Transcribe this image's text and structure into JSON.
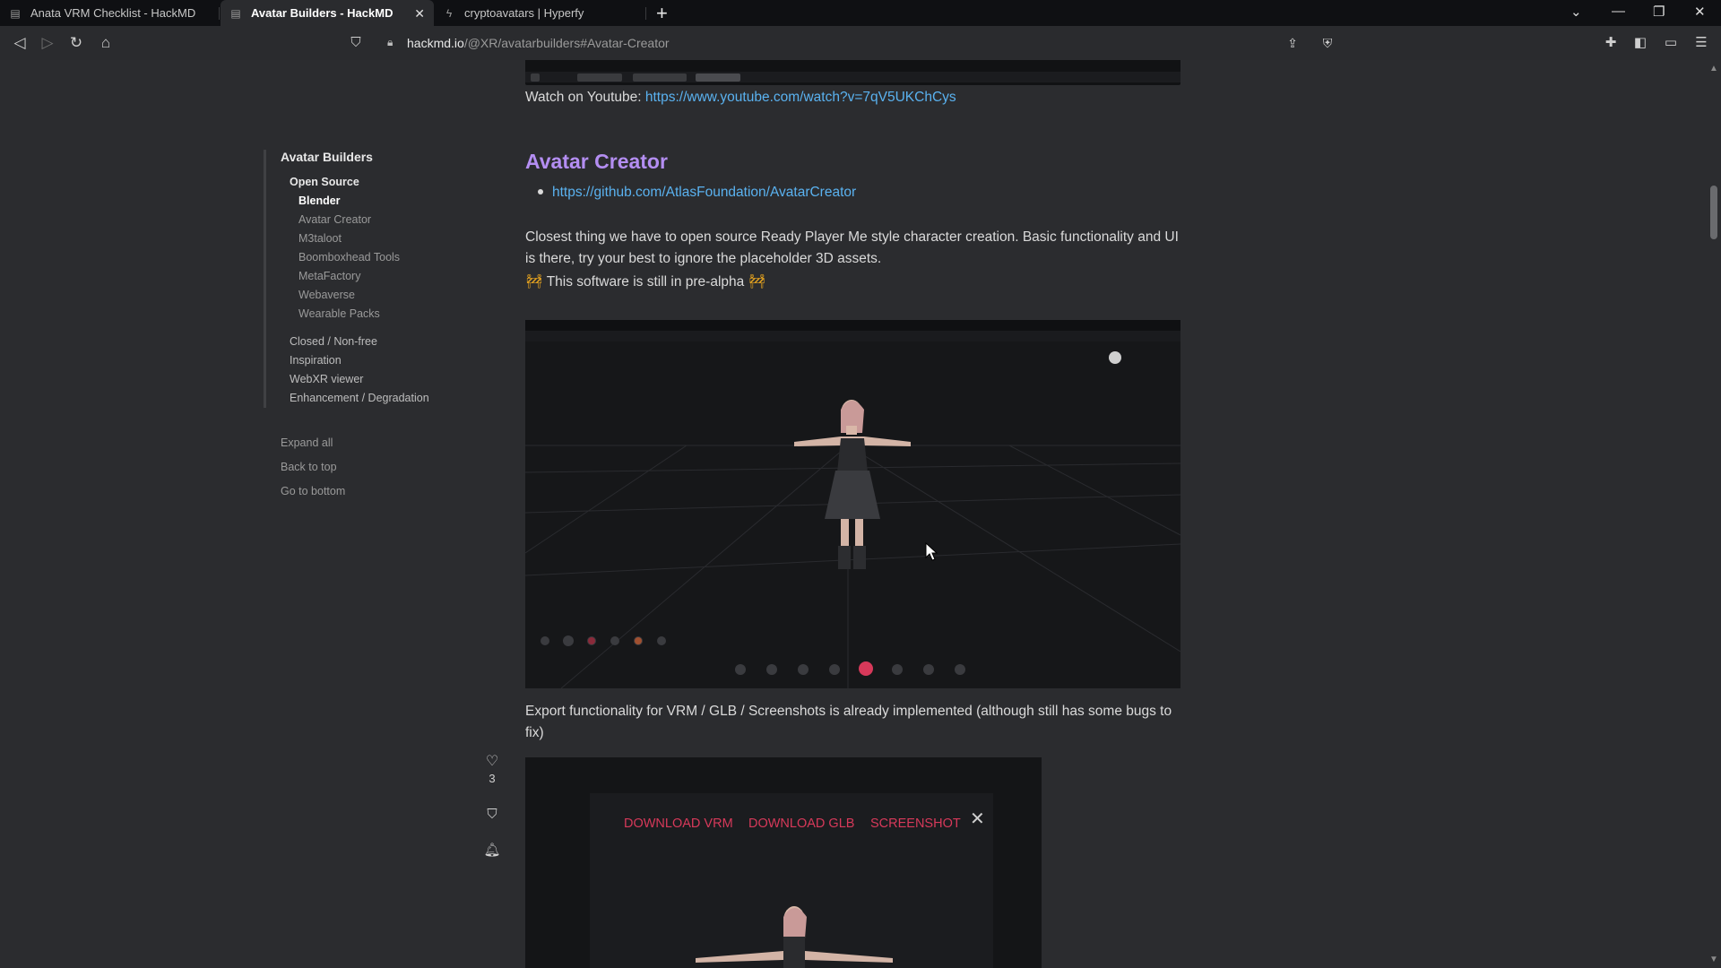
{
  "browser": {
    "tabs": [
      {
        "title": "Anata VRM Checklist - HackMD",
        "active": false
      },
      {
        "title": "Avatar Builders - HackMD",
        "active": true
      },
      {
        "title": "cryptoavatars | Hyperfy",
        "active": false
      }
    ],
    "url": {
      "host": "hackmd.io",
      "path": "/@XR/avatarbuilders#Avatar-Creator"
    }
  },
  "toc": {
    "title": "Avatar Builders",
    "sections": [
      {
        "label": "Open Source",
        "items": [
          "Blender",
          "Avatar Creator",
          "M3taloot",
          "Boomboxhead Tools",
          "MetaFactory",
          "Webaverse",
          "Wearable Packs"
        ]
      },
      {
        "label": "Closed / Non-free"
      },
      {
        "label": "Inspiration"
      },
      {
        "label": "WebXR viewer"
      },
      {
        "label": "Enhancement / Degradation"
      }
    ],
    "links": [
      "Expand all",
      "Back to top",
      "Go to bottom"
    ]
  },
  "side_actions": {
    "like_count": "3"
  },
  "content": {
    "watch_label": "Watch on Youtube: ",
    "watch_url": "https://www.youtube.com/watch?v=7qV5UKChCys",
    "heading": "Avatar Creator",
    "repo_url": "https://github.com/AtlasFoundation/AvatarCreator",
    "para1": "Closest thing we have to open source Ready Player Me style character creation. Basic functionality and UI is there, try your best to ignore the placeholder 3D assets.",
    "prealpha": "This software is still in pre-alpha",
    "para2": "Export functionality for VRM / GLB / Screenshots is already implemented (although still has some bugs to fix)",
    "export_buttons": [
      "DOWNLOAD VRM",
      "DOWNLOAD GLB",
      "SCREENSHOT"
    ]
  },
  "colors": {
    "accent_heading": "#b48ef2",
    "link": "#5ab2f0",
    "export_button": "#d7395a"
  }
}
